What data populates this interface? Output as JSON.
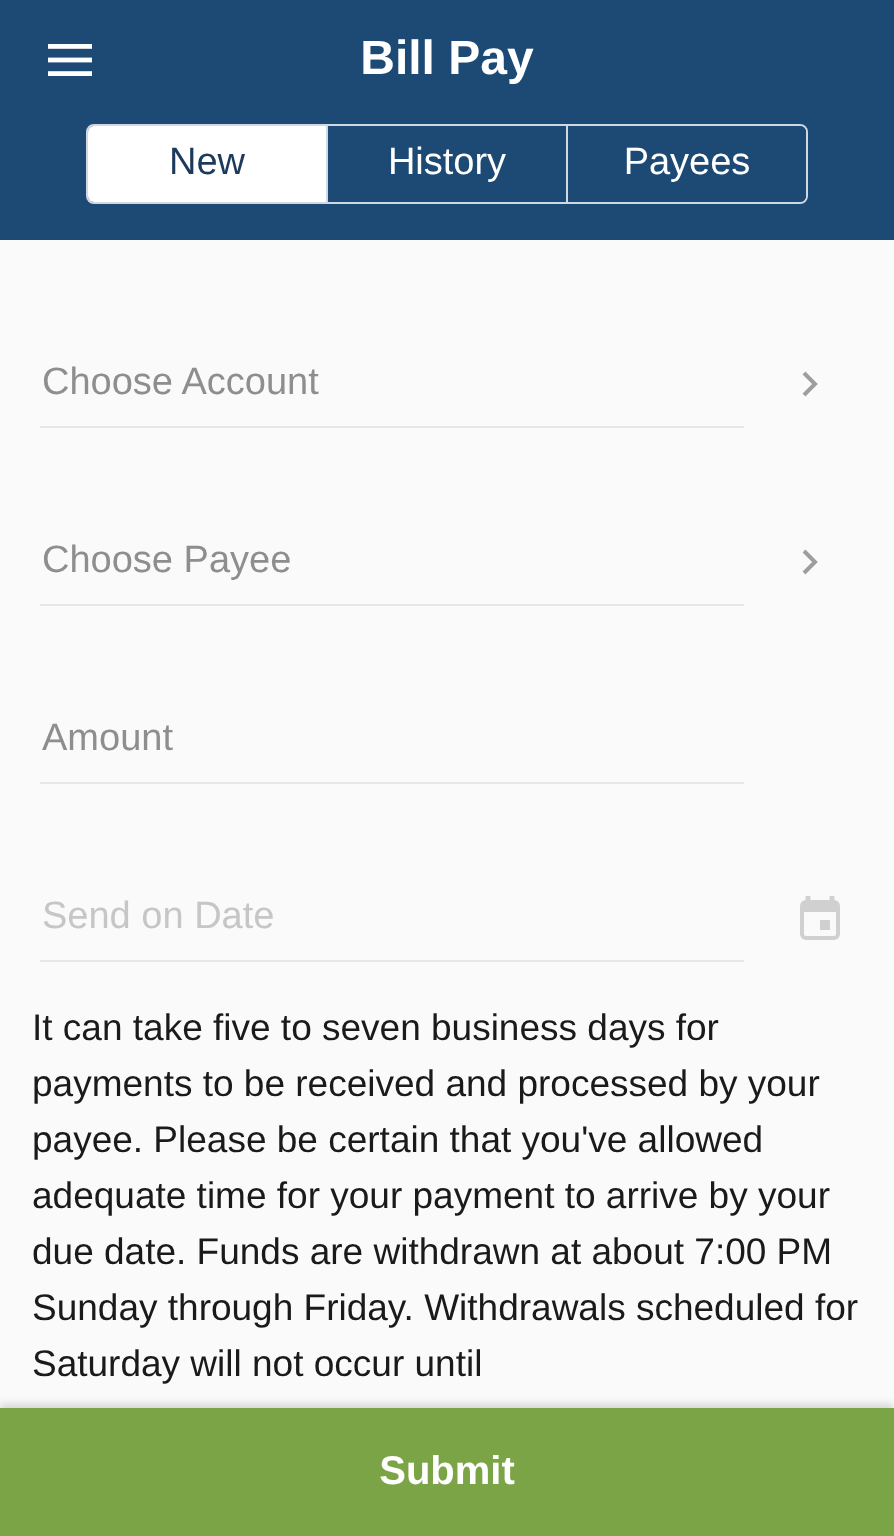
{
  "header": {
    "title": "Bill Pay"
  },
  "tabs": [
    {
      "label": "New",
      "selected": true
    },
    {
      "label": "History",
      "selected": false
    },
    {
      "label": "Payees",
      "selected": false
    }
  ],
  "fields": [
    {
      "kind": "select",
      "placeholder": "Choose Account",
      "disabled": false
    },
    {
      "kind": "select",
      "placeholder": "Choose Payee",
      "disabled": false
    },
    {
      "kind": "text",
      "placeholder": "Amount",
      "disabled": false
    },
    {
      "kind": "date",
      "placeholder": "Send on Date",
      "disabled": true
    }
  ],
  "notice": "It can take five to seven business days for payments to be received and processed by your payee. Please be certain that you've allowed adequate time for your payment to arrive by your due date. Funds are withdrawn at about 7:00 PM Sunday through Friday. Withdrawals scheduled for Saturday will not occur until",
  "submit": {
    "label": "Submit"
  }
}
